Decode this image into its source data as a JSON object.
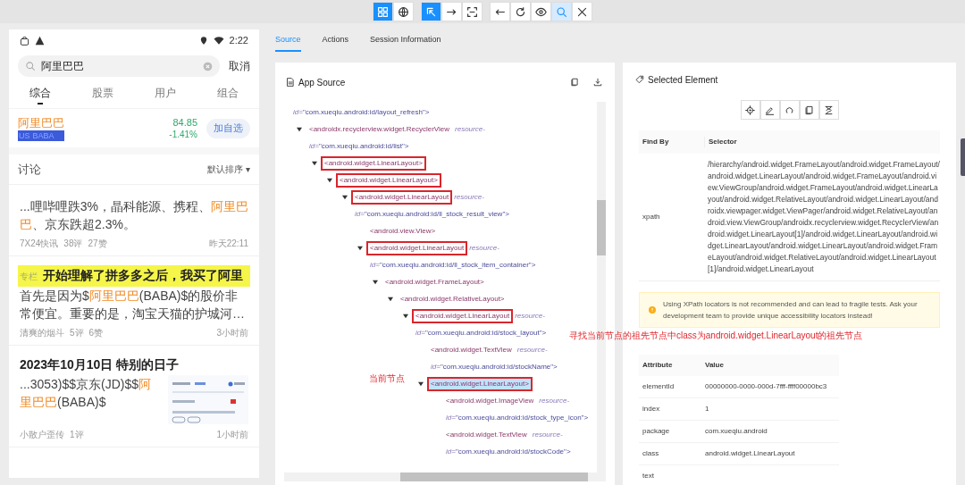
{
  "toolbar": {
    "groups": [
      [
        {
          "kind": "grid",
          "selected": true
        },
        {
          "kind": "globe",
          "selected": false
        }
      ],
      [
        {
          "kind": "cursor",
          "selected": true
        },
        {
          "kind": "swipe",
          "selected": false
        },
        {
          "kind": "expand",
          "selected": false
        }
      ],
      [
        {
          "kind": "back",
          "selected": false
        },
        {
          "kind": "refresh",
          "selected": false
        },
        {
          "kind": "eye",
          "selected": false
        },
        {
          "kind": "search",
          "selected": true
        },
        {
          "kind": "close",
          "selected": false
        }
      ]
    ]
  },
  "phone": {
    "status_time": "2:22",
    "search": {
      "value": "阿里巴巴",
      "cancel": "取消"
    },
    "tabs": [
      {
        "label": "综合",
        "selected": true
      },
      {
        "label": "股票",
        "selected": false
      },
      {
        "label": "用户",
        "selected": false
      },
      {
        "label": "组合",
        "selected": false
      }
    ],
    "stock": {
      "name": "阿里巴巴",
      "market": "US",
      "code": "BABA",
      "highlighted": true,
      "price": "84.85",
      "change": "-1.41%",
      "button": "加自选"
    },
    "section": {
      "title": "讨论",
      "sort": "默认排序 ▾"
    },
    "posts": [
      {
        "highlighted": false,
        "body": [
          {
            "text": "...哩哔哩跌3%，晶科能源、携程、",
            "match": false
          },
          {
            "text": "阿里巴巴",
            "match": true
          },
          {
            "text": "、京东跌超2.3%。",
            "match": false
          }
        ],
        "author": "7X24快讯",
        "comments": "38评",
        "likes": "27赞",
        "time": "昨天22:11",
        "picture": false
      },
      {
        "tag": "专栏",
        "title": "开始理解了拼多多之后，我买了阿里",
        "highlighted": true,
        "body": [
          {
            "text": "首先是因为$",
            "match": false
          },
          {
            "text": "阿里巴巴",
            "match": true
          },
          {
            "text": "(BABA)$的股价非常便宜。重要的是，淘宝天猫的护城河…",
            "match": false
          }
        ],
        "author": "清爽的烟斗",
        "comments": "5评",
        "likes": "6赞",
        "time": "3小时前",
        "picture": false
      },
      {
        "title": "2023年10月10日 特别的日子",
        "highlighted": false,
        "body": [
          {
            "text": "...3053)$$京东(JD)$$",
            "match": false
          },
          {
            "text": "阿里巴巴",
            "match": true
          },
          {
            "text": "(BABA)$",
            "match": false
          }
        ],
        "author": "小散户歪传",
        "comments": "1评",
        "time": "1小时前",
        "picture": true
      }
    ]
  },
  "tabs": [
    {
      "label": "Source",
      "selected": true
    },
    {
      "label": "Actions",
      "selected": false
    },
    {
      "label": "Session Information",
      "selected": false
    }
  ],
  "source": {
    "title": "App Source",
    "cut_line": {
      "key": "id=",
      "value": "\"com.xueqiu.android:id/layout_refresh\">"
    },
    "tree": [
      {
        "kind": "branch",
        "expanded": true,
        "boxed": false,
        "selected": false,
        "tag": "<androidx.recyclerview.widget.RecyclerView",
        "attr": "resource-",
        "key": "id=",
        "value": "\"com.xueqiu.android:id/list\">",
        "children": [
          {
            "kind": "branch",
            "expanded": true,
            "boxed": true,
            "selected": false,
            "tag": "<android.widget.LinearLayout>",
            "children": [
              {
                "kind": "branch",
                "expanded": true,
                "boxed": true,
                "selected": false,
                "tag": "<android.widget.LinearLayout>",
                "children": [
                  {
                    "kind": "branch",
                    "expanded": true,
                    "boxed": true,
                    "selected": false,
                    "tag": "<android.widget.LinearLayout",
                    "attr": "resource-",
                    "key": "id=",
                    "value": "\"com.xueqiu.android:id/ll_stock_result_view\">",
                    "children": [
                      {
                        "kind": "leaf",
                        "boxed": false,
                        "selected": false,
                        "tag": "<android.view.View>"
                      },
                      {
                        "kind": "branch",
                        "expanded": true,
                        "boxed": true,
                        "selected": false,
                        "tag": "<android.widget.LinearLayout",
                        "attr": "resource-",
                        "key": "id=",
                        "value": "\"com.xueqiu.android:id/ll_stock_item_container\">",
                        "children": [
                          {
                            "kind": "branch",
                            "expanded": true,
                            "boxed": false,
                            "selected": false,
                            "tag": "<android.widget.FrameLayout>",
                            "children": [
                              {
                                "kind": "branch",
                                "expanded": true,
                                "boxed": false,
                                "selected": false,
                                "tag": "<android.widget.RelativeLayout>",
                                "children": [
                                  {
                                    "kind": "branch",
                                    "expanded": true,
                                    "boxed": true,
                                    "selected": false,
                                    "tag": "<android.widget.LinearLayout",
                                    "attr": "resource-",
                                    "key": "id=",
                                    "value": "\"com.xueqiu.android:id/stock_layout\">",
                                    "children": [
                                      {
                                        "kind": "leaf",
                                        "boxed": false,
                                        "selected": false,
                                        "tag": "<android.widget.TextView",
                                        "attr": "resource-",
                                        "key": "id=",
                                        "value": "\"com.xueqiu.android:id/stockName\">"
                                      },
                                      {
                                        "kind": "branch",
                                        "expanded": true,
                                        "boxed": true,
                                        "selected": true,
                                        "tag": "<android.widget.LinearLayout>",
                                        "children": [
                                          {
                                            "kind": "leaf",
                                            "boxed": false,
                                            "selected": false,
                                            "tag": "<android.widget.ImageView",
                                            "attr": "resource-",
                                            "key": "id=",
                                            "value": "\"com.xueqiu.android:id/stock_type_icon\">"
                                          },
                                          {
                                            "kind": "leaf",
                                            "boxed": false,
                                            "selected": false,
                                            "tag": "<android.widget.TextView",
                                            "attr": "resource-",
                                            "key": "id=",
                                            "value": "\"com.xueqiu.android:id/stockCode\">"
                                          }
                                        ]
                                      }
                                    ]
                                  }
                                ]
                              }
                            ]
                          }
                        ]
                      }
                    ]
                  }
                ]
              }
            ]
          }
        ]
      }
    ]
  },
  "selected": {
    "title": "Selected Element",
    "actions": [
      {
        "kind": "locate"
      },
      {
        "kind": "edit"
      },
      {
        "kind": "refresh"
      },
      {
        "kind": "copy"
      },
      {
        "kind": "hourglass"
      }
    ],
    "selector_columns": [
      "Find By",
      "Selector"
    ],
    "selectors": [
      {
        "find_by": "xpath",
        "selector": "/hierarchy/android.widget.FrameLayout/android.widget.FrameLayout/android.widget.LinearLayout/android.widget.FrameLayout/android.view.ViewGroup/android.widget.FrameLayout/android.widget.LinearLayout/android.widget.RelativeLayout/android.widget.LinearLayout/androidx.viewpager.widget.ViewPager/android.widget.RelativeLayout/android.view.ViewGroup/androidx.recyclerview.widget.RecyclerView/android.widget.LinearLayout[1]/android.widget.LinearLayout/android.widget.LinearLayout/android.widget.LinearLayout/android.widget.FrameLayout/android.widget.RelativeLayout/android.widget.LinearLayout[1]/android.widget.LinearLayout"
      }
    ],
    "warning": "Using XPath locators is not recommended and can lead to fragile tests. Ask your development team to provide unique accessibility locators instead!",
    "attribute_columns": [
      "Attribute",
      "Value"
    ],
    "attributes": [
      {
        "name": "elementId",
        "value": "00000000-0000-000d-7fff-ffff00000bc3"
      },
      {
        "name": "index",
        "value": "1"
      },
      {
        "name": "package",
        "value": "com.xueqiu.android"
      },
      {
        "name": "class",
        "value": "android.widget.LinearLayout"
      },
      {
        "name": "text"
      }
    ]
  },
  "annotations": [
    {
      "kind": "current",
      "text": "当前节点"
    },
    {
      "kind": "ancestor",
      "text": "寻找当前节点的祖先节点中class为android.widget.LinearLayout的祖先节点"
    }
  ]
}
